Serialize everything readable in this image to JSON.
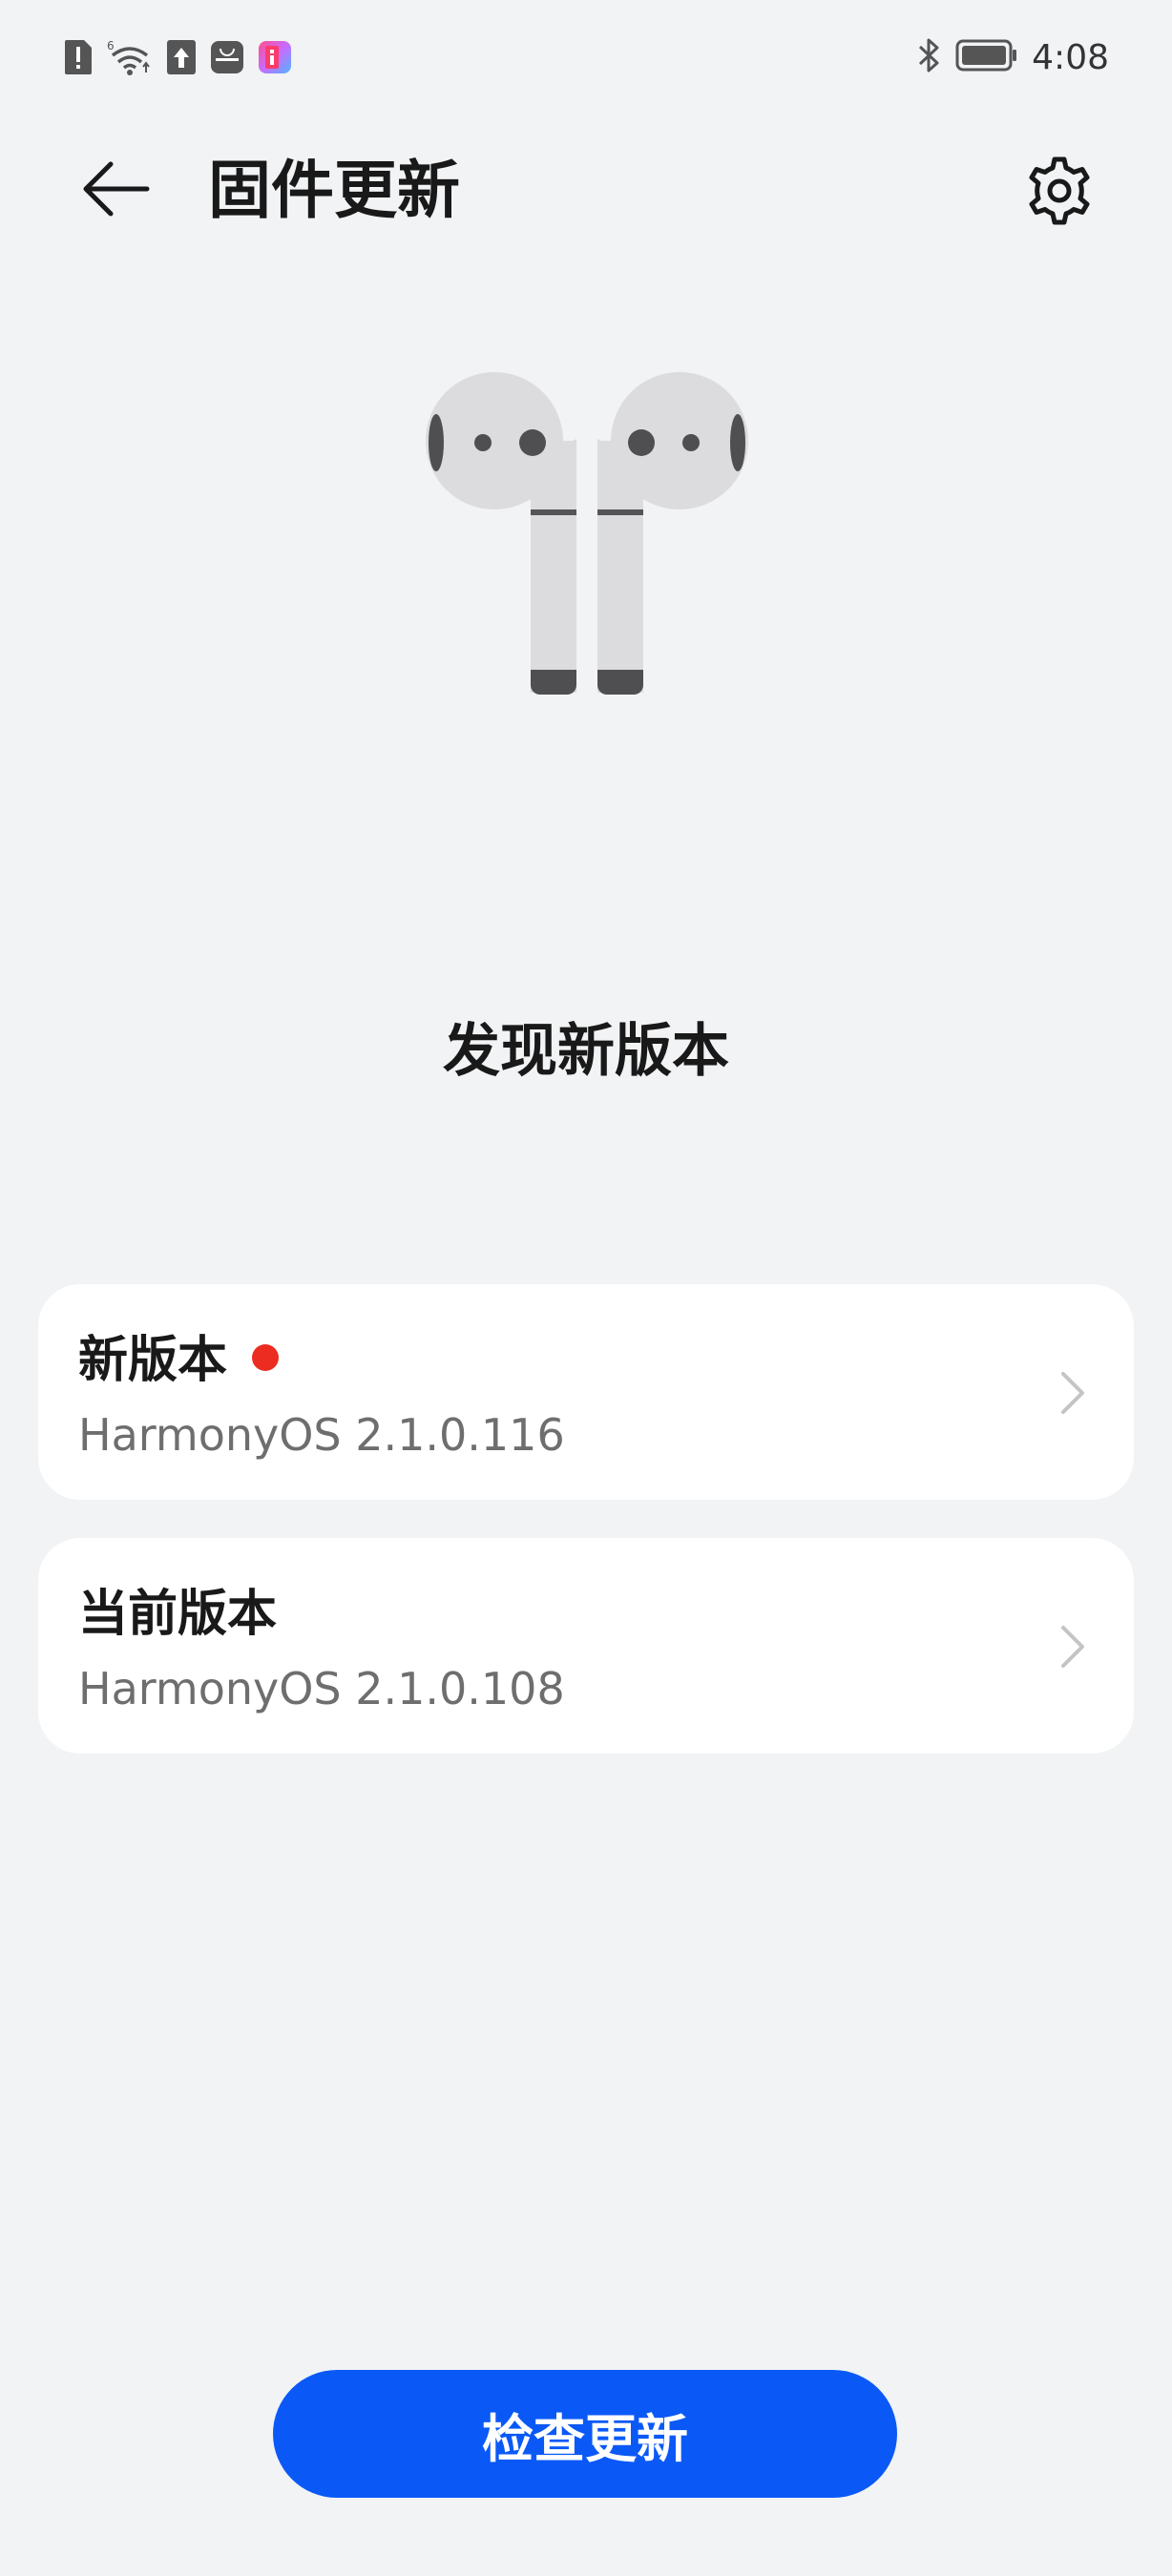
{
  "status_bar": {
    "time": "4:08",
    "left_icons": [
      "alert-icon",
      "wifi-6-icon",
      "upload-icon",
      "huawei-store-icon",
      "app-icon"
    ],
    "right_icons": [
      "bluetooth-icon",
      "battery-icon"
    ]
  },
  "header": {
    "title": "固件更新",
    "back_icon": "back-arrow-icon",
    "settings_icon": "gear-icon"
  },
  "headline": "发现新版本",
  "cards": [
    {
      "title": "新版本",
      "version": "HarmonyOS 2.1.0.116",
      "has_badge": true
    },
    {
      "title": "当前版本",
      "version": "HarmonyOS 2.1.0.108",
      "has_badge": false
    }
  ],
  "action_button": {
    "label": "检查更新"
  },
  "colors": {
    "background": "#f1f3f5",
    "card": "#ffffff",
    "accent": "#0a59f7",
    "badge": "#ec2c21",
    "secondary_text": "#6e6e6e"
  }
}
